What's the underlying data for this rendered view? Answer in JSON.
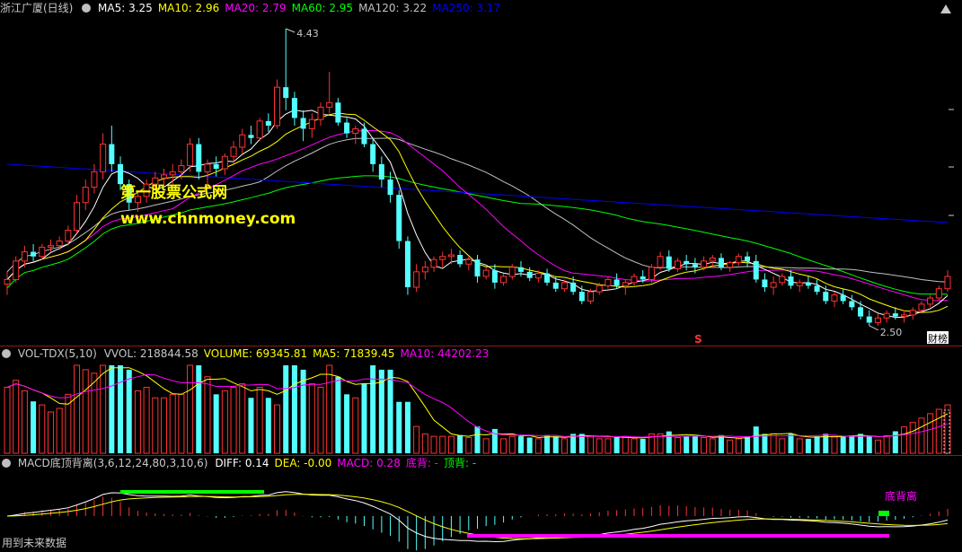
{
  "main": {
    "title": "浙江广厦(日线)",
    "ma_labels": [
      {
        "text": "MA5: 3.25",
        "color": "#ffffff"
      },
      {
        "text": "MA10: 2.96",
        "color": "#ffff00"
      },
      {
        "text": "MA20: 2.79",
        "color": "#ff00ff"
      },
      {
        "text": "MA60: 2.95",
        "color": "#00ff00"
      },
      {
        "text": "MA120: 3.22",
        "color": "#c0c0c0"
      },
      {
        "text": "MA250: 3.17",
        "color": "#0000ff"
      }
    ],
    "high_label": "4.43",
    "low_label": "2.50",
    "marker_s": "S",
    "marker_caibang": "财榜",
    "scroll_icon": "up-triangle-icon"
  },
  "watermark": {
    "line1": "第一股票公式网",
    "line2": "www.chnmoney.com"
  },
  "volume": {
    "title": "VOL-TDX(5,10)",
    "labels": [
      {
        "text": "VVOL: 218844.58",
        "color": "#c8c8c8"
      },
      {
        "text": "VOLUME: 69345.81",
        "color": "#ffff00"
      },
      {
        "text": "MA5: 71839.45",
        "color": "#ffff00"
      },
      {
        "text": "MA10: 44202.23",
        "color": "#ff00ff"
      }
    ]
  },
  "macd": {
    "title": "MACD底顶背离(3,6,12,24,80,3,10,6)",
    "labels": [
      {
        "text": "DIFF: 0.14",
        "color": "#ffffff"
      },
      {
        "text": "DEA: -0.00",
        "color": "#ffff00"
      },
      {
        "text": "MACD: 0.28",
        "color": "#ff00ff"
      },
      {
        "text": "底背: -",
        "color": "#ff00ff"
      },
      {
        "text": "顶背: -",
        "color": "#00ff00"
      }
    ],
    "divergence_label": "底背离"
  },
  "footer": {
    "future_data": "用到未来数据"
  },
  "colors": {
    "up": "#ff3232",
    "down": "#54ffff",
    "ma5": "#ffffff",
    "ma10": "#ffff00",
    "ma20": "#ff00ff",
    "ma60": "#00ff00",
    "ma120": "#c0c0c0",
    "ma250": "#0000ff"
  },
  "chart_data": {
    "type": "candlestick",
    "title": "浙江广厦(日线)",
    "price_high": 4.43,
    "price_low": 2.5,
    "candles": [
      [
        2.77,
        2.85,
        2.7,
        2.8
      ],
      [
        2.8,
        2.95,
        2.78,
        2.92
      ],
      [
        2.92,
        3.02,
        2.88,
        2.98
      ],
      [
        2.98,
        3.03,
        2.92,
        2.95
      ],
      [
        2.95,
        3.03,
        2.93,
        3.01
      ],
      [
        3.01,
        3.06,
        2.98,
        3.02
      ],
      [
        3.02,
        3.08,
        2.99,
        3.05
      ],
      [
        3.05,
        3.15,
        3.02,
        3.12
      ],
      [
        3.12,
        3.35,
        3.1,
        3.3
      ],
      [
        3.3,
        3.45,
        3.25,
        3.4
      ],
      [
        3.4,
        3.55,
        3.36,
        3.5
      ],
      [
        3.5,
        3.75,
        3.45,
        3.68
      ],
      [
        3.68,
        3.8,
        3.5,
        3.55
      ],
      [
        3.55,
        3.6,
        3.38,
        3.42
      ],
      [
        3.42,
        3.45,
        3.25,
        3.3
      ],
      [
        3.3,
        3.38,
        3.24,
        3.34
      ],
      [
        3.34,
        3.45,
        3.3,
        3.42
      ],
      [
        3.42,
        3.5,
        3.38,
        3.46
      ],
      [
        3.46,
        3.52,
        3.4,
        3.48
      ],
      [
        3.48,
        3.55,
        3.42,
        3.5
      ],
      [
        3.5,
        3.58,
        3.45,
        3.54
      ],
      [
        3.54,
        3.72,
        3.5,
        3.68
      ],
      [
        3.68,
        3.72,
        3.45,
        3.5
      ],
      [
        3.5,
        3.58,
        3.4,
        3.55
      ],
      [
        3.55,
        3.6,
        3.47,
        3.52
      ],
      [
        3.52,
        3.62,
        3.48,
        3.6
      ],
      [
        3.6,
        3.7,
        3.55,
        3.66
      ],
      [
        3.66,
        3.78,
        3.62,
        3.74
      ],
      [
        3.74,
        3.8,
        3.68,
        3.72
      ],
      [
        3.72,
        3.85,
        3.7,
        3.83
      ],
      [
        3.83,
        3.88,
        3.76,
        3.8
      ],
      [
        3.8,
        4.1,
        3.78,
        4.05
      ],
      [
        4.05,
        4.43,
        3.9,
        3.98
      ],
      [
        3.98,
        4.02,
        3.8,
        3.85
      ],
      [
        3.85,
        3.9,
        3.7,
        3.78
      ],
      [
        3.78,
        3.88,
        3.72,
        3.84
      ],
      [
        3.84,
        3.95,
        3.8,
        3.92
      ],
      [
        3.92,
        4.15,
        3.88,
        3.95
      ],
      [
        3.95,
        3.98,
        3.8,
        3.82
      ],
      [
        3.82,
        3.85,
        3.72,
        3.75
      ],
      [
        3.75,
        3.8,
        3.68,
        3.78
      ],
      [
        3.78,
        3.82,
        3.66,
        3.68
      ],
      [
        3.68,
        3.72,
        3.5,
        3.55
      ],
      [
        3.55,
        3.6,
        3.4,
        3.45
      ],
      [
        3.45,
        3.5,
        3.3,
        3.35
      ],
      [
        3.35,
        3.38,
        3.0,
        3.05
      ],
      [
        3.05,
        3.08,
        2.7,
        2.75
      ],
      [
        2.75,
        2.9,
        2.72,
        2.85
      ],
      [
        2.85,
        2.92,
        2.8,
        2.88
      ],
      [
        2.88,
        2.95,
        2.85,
        2.93
      ],
      [
        2.93,
        2.98,
        2.88,
        2.95
      ],
      [
        2.95,
        3.0,
        2.9,
        2.96
      ],
      [
        2.96,
        2.99,
        2.88,
        2.9
      ],
      [
        2.9,
        2.95,
        2.86,
        2.93
      ],
      [
        2.93,
        2.96,
        2.78,
        2.82
      ],
      [
        2.82,
        2.88,
        2.8,
        2.86
      ],
      [
        2.86,
        2.9,
        2.74,
        2.78
      ],
      [
        2.78,
        2.84,
        2.76,
        2.82
      ],
      [
        2.82,
        2.9,
        2.8,
        2.88
      ],
      [
        2.88,
        2.92,
        2.82,
        2.85
      ],
      [
        2.85,
        2.88,
        2.79,
        2.81
      ],
      [
        2.81,
        2.86,
        2.78,
        2.84
      ],
      [
        2.84,
        2.87,
        2.76,
        2.78
      ],
      [
        2.78,
        2.82,
        2.72,
        2.74
      ],
      [
        2.74,
        2.8,
        2.72,
        2.78
      ],
      [
        2.78,
        2.82,
        2.7,
        2.72
      ],
      [
        2.72,
        2.76,
        2.64,
        2.66
      ],
      [
        2.66,
        2.74,
        2.64,
        2.72
      ],
      [
        2.72,
        2.78,
        2.7,
        2.76
      ],
      [
        2.76,
        2.82,
        2.74,
        2.8
      ],
      [
        2.8,
        2.84,
        2.74,
        2.76
      ],
      [
        2.76,
        2.8,
        2.7,
        2.78
      ],
      [
        2.78,
        2.84,
        2.76,
        2.82
      ],
      [
        2.82,
        2.86,
        2.78,
        2.8
      ],
      [
        2.8,
        2.9,
        2.78,
        2.88
      ],
      [
        2.88,
        2.98,
        2.86,
        2.95
      ],
      [
        2.95,
        2.99,
        2.85,
        2.87
      ],
      [
        2.87,
        2.94,
        2.85,
        2.92
      ],
      [
        2.92,
        2.96,
        2.86,
        2.9
      ],
      [
        2.9,
        2.94,
        2.84,
        2.88
      ],
      [
        2.88,
        2.95,
        2.86,
        2.92
      ],
      [
        2.92,
        2.96,
        2.88,
        2.94
      ],
      [
        2.94,
        2.97,
        2.86,
        2.88
      ],
      [
        2.88,
        2.92,
        2.85,
        2.91
      ],
      [
        2.91,
        2.97,
        2.89,
        2.95
      ],
      [
        2.95,
        2.98,
        2.88,
        2.92
      ],
      [
        2.92,
        2.96,
        2.78,
        2.8
      ],
      [
        2.8,
        2.84,
        2.72,
        2.75
      ],
      [
        2.75,
        2.82,
        2.7,
        2.78
      ],
      [
        2.78,
        2.84,
        2.76,
        2.82
      ],
      [
        2.82,
        2.86,
        2.74,
        2.76
      ],
      [
        2.76,
        2.8,
        2.72,
        2.78
      ],
      [
        2.78,
        2.82,
        2.74,
        2.76
      ],
      [
        2.76,
        2.8,
        2.7,
        2.72
      ],
      [
        2.72,
        2.76,
        2.64,
        2.66
      ],
      [
        2.66,
        2.72,
        2.62,
        2.7
      ],
      [
        2.7,
        2.74,
        2.64,
        2.66
      ],
      [
        2.66,
        2.7,
        2.6,
        2.62
      ],
      [
        2.62,
        2.66,
        2.54,
        2.56
      ],
      [
        2.56,
        2.6,
        2.5,
        2.52
      ],
      [
        2.52,
        2.58,
        2.5,
        2.55
      ],
      [
        2.55,
        2.6,
        2.52,
        2.58
      ],
      [
        2.58,
        2.62,
        2.54,
        2.56
      ],
      [
        2.56,
        2.6,
        2.52,
        2.57
      ],
      [
        2.57,
        2.62,
        2.54,
        2.6
      ],
      [
        2.6,
        2.66,
        2.58,
        2.64
      ],
      [
        2.64,
        2.7,
        2.62,
        2.68
      ],
      [
        2.68,
        2.76,
        2.66,
        2.74
      ],
      [
        2.74,
        2.86,
        2.72,
        2.82
      ]
    ],
    "volume_note": "volume bars follow candle color; tallest spike at the 4.43 high",
    "macd_note": "DIFF/DEA lines with red/cyan histogram; magenta bottom band and green divergence markers"
  }
}
